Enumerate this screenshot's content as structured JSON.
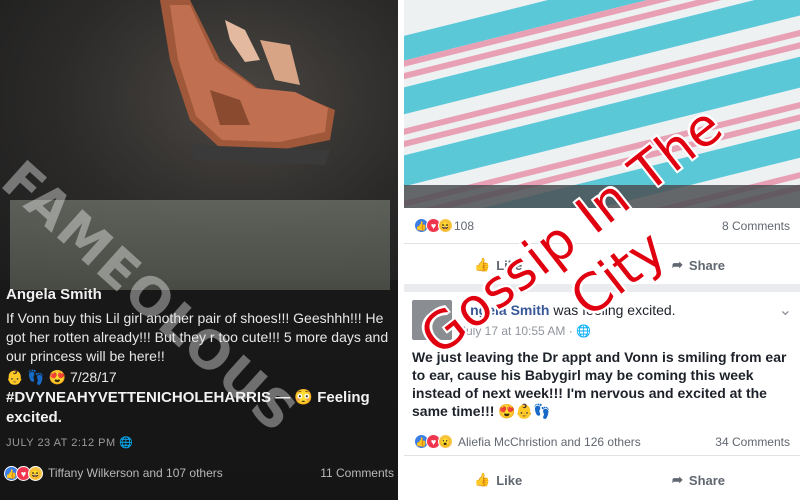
{
  "left_post": {
    "watermark": "FAMEOLOUS",
    "author": "Angela Smith",
    "text": "If Vonn buy this Lil girl another pair of shoes!!! Geeshhh!!! He got her rotten already!!! But they r too cute!!! 5 more days and our princess will be here!!",
    "emoji_line": "👶 👣 😍 7/28/17",
    "hashtag": "#DVYNEAHYVETTENICHOLEHARRIS — 😳 Feeling excited.",
    "timestamp": "JULY 23 AT 2:12 PM",
    "reaction_names": "Tiffany Wilkerson and 107 others",
    "comments": "11 Comments"
  },
  "right_top": {
    "reaction_count": "108",
    "comments": "8 Comments",
    "like_label": "Like",
    "share_label": "Share"
  },
  "right_post": {
    "author": "Angela Smith",
    "activity_prefix": "was",
    "activity": "feeling excited.",
    "time": "July 17 at 10:55 AM · ",
    "text": "We just leaving the Dr appt and Vonn is smiling from ear to ear, cause his Babygirl may be coming this week instead of next week!!! I'm nervous and excited at the same time!!! 😍👶👣",
    "reaction_names": "Aliefia McChristion and 126 others",
    "comments": "34 Comments",
    "like_label": "Like",
    "share_label": "Share"
  },
  "overlay": {
    "line1": "Gossip In The",
    "line2": "City"
  },
  "colors": {
    "fb_blue": "#385898",
    "like_blue": "#3b7ee8",
    "love_red": "#f0364f",
    "overlay_red": "#e0000f",
    "blanket_blue": "#5bc8d8",
    "blanket_pink": "#e8a0b4"
  }
}
